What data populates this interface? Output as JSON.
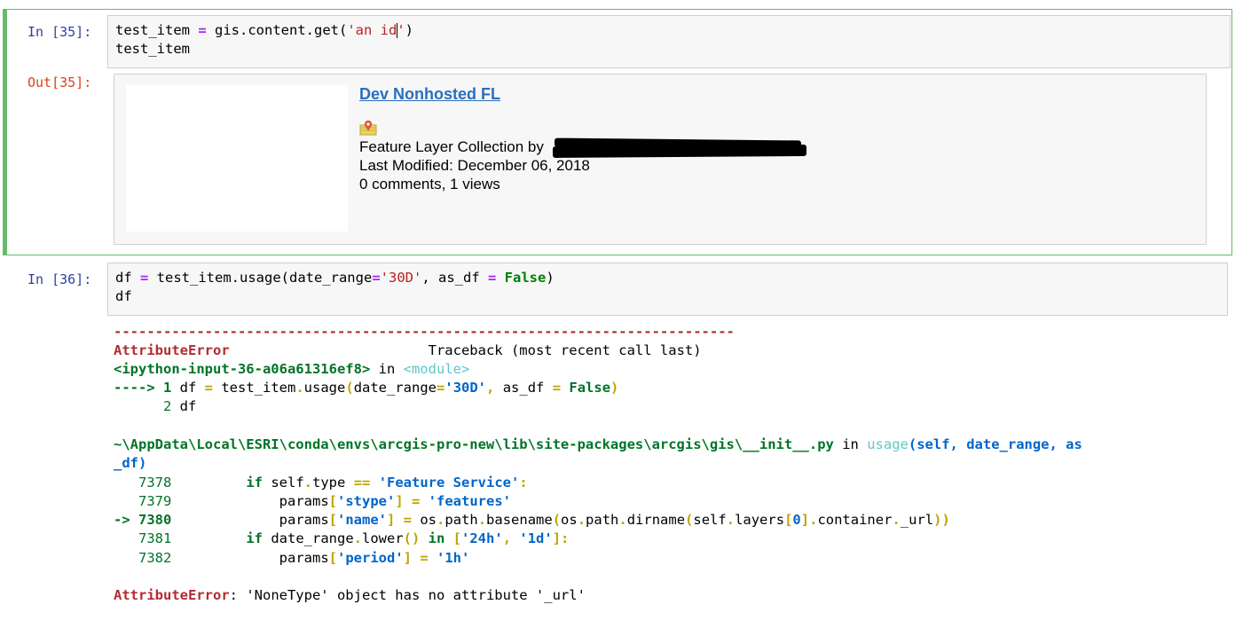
{
  "cells": [
    {
      "prompt_in": "In [35]:",
      "prompt_out": "Out[35]:",
      "code_line1_a": "test_item ",
      "code_line1_op": "=",
      "code_line1_b": " gis.content.get(",
      "code_line1_str_a": "'an id",
      "code_line1_str_b": "'",
      "code_line1_c": ")",
      "code_line2": "test_item",
      "output": {
        "title": "Dev Nonhosted FL",
        "icon": "feature-layer-collection-icon",
        "type_line": "Feature Layer Collection by",
        "modified_line": "Last Modified: December 06, 2018",
        "stats_line": "0 comments, 1 views"
      }
    },
    {
      "prompt_in": "In [36]:",
      "code_line1_a": "df ",
      "code_line1_op1": "=",
      "code_line1_b": " test_item.usage(date_range",
      "code_line1_op2": "=",
      "code_line1_str": "'30D'",
      "code_line1_c": ", as_df ",
      "code_line1_op3": "=",
      "code_line1_kw": "False",
      "code_line1_d": ")",
      "code_line2": "df",
      "traceback": {
        "rule": "---------------------------------------------------------------------------",
        "error_name": "AttributeError",
        "header_right": "Traceback (most recent call last)",
        "frame1_file": "<ipython-input-36-a06a61316ef8>",
        "frame1_in": " in ",
        "frame1_module": "<module>",
        "frame1_arrow": "----> 1",
        "frame1_code_a": " df ",
        "frame1_code_op1": "=",
        "frame1_code_b": " test_item",
        "frame1_code_c": ".",
        "frame1_code_d": "usage",
        "frame1_code_e": "(",
        "frame1_code_f": "date_range",
        "frame1_code_op2": "=",
        "frame1_code_str": "'30D'",
        "frame1_code_g": ",",
        "frame1_code_h": " as_df ",
        "frame1_code_op3": "=",
        "frame1_code_kw": " False",
        "frame1_code_i": ")",
        "frame1_line2_num": "      2",
        "frame1_line2_code": " df",
        "frame2_file": "~\\AppData\\Local\\ESRI\\conda\\envs\\arcgis-pro-new\\lib\\site-packages\\arcgis\\gis\\__init__.py",
        "frame2_in": " in ",
        "frame2_func": "usage",
        "frame2_args": "(self, date_range, as",
        "frame2_args_wrap": "_df)",
        "lines": [
          {
            "num": "   7378",
            "indent": "         ",
            "code_kw": "if",
            "code_rest_a": " self",
            "code_rest_b": ".",
            "code_rest_c": "type ",
            "code_op": "==",
            "code_str": " 'Feature Service'",
            "code_end": ":"
          },
          {
            "num": "   7379",
            "indent": "             ",
            "code_a": "params",
            "code_b": "[",
            "code_str": "'stype'",
            "code_c": "]",
            "code_op": " =",
            "code_str2": " 'features'"
          },
          {
            "num": "-> 7380",
            "indent": "             ",
            "code_a": "params",
            "code_b": "[",
            "code_str": "'name'",
            "code_c": "]",
            "code_op": " =",
            "code_d": " os",
            "code_e": ".",
            "code_f": "path",
            "code_g": ".",
            "code_h": "basename",
            "code_i": "(",
            "code_j": "os",
            "code_k": ".",
            "code_l": "path",
            "code_m": ".",
            "code_n": "dirname",
            "code_o": "(",
            "code_p": "self",
            "code_q": ".",
            "code_r": "layers",
            "code_s": "[",
            "code_t": "0",
            "code_u": "]",
            "code_v": ".",
            "code_w": "container",
            "code_x": ".",
            "code_y": "_url",
            "code_z": "))"
          },
          {
            "num": "   7381",
            "indent": "         ",
            "code_kw": "if",
            "code_a": " date_range",
            "code_b": ".",
            "code_c": "lower",
            "code_d": "()",
            "code_kw2": " in",
            "code_e": " [",
            "code_str": "'24h'",
            "code_f": ",",
            "code_str2": " '1d'",
            "code_g": "]:"
          },
          {
            "num": "   7382",
            "indent": "             ",
            "code_a": "params",
            "code_b": "[",
            "code_str": "'period'",
            "code_c": "]",
            "code_op": " =",
            "code_str2": " '1h'"
          }
        ],
        "final_error": "AttributeError",
        "final_message": ": 'NoneType' object has no attribute '_url'"
      }
    }
  ],
  "colors": {
    "selected_border": "#66bb6a",
    "prompt_in": "#303f9f",
    "prompt_out": "#d84315",
    "link": "#2a6fbe"
  }
}
